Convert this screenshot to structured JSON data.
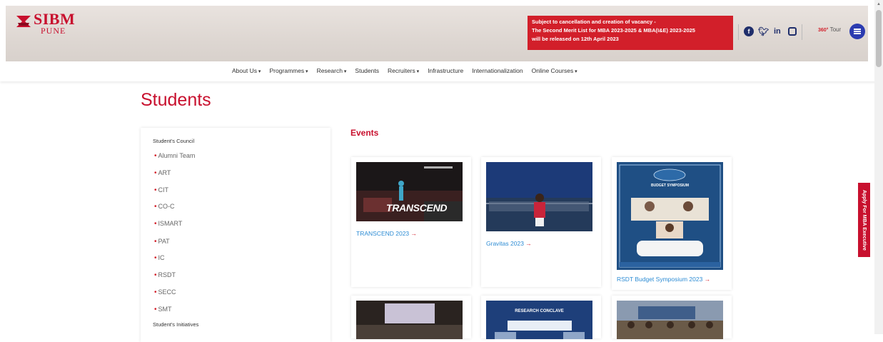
{
  "brand": {
    "name": "SIBM",
    "city": "PUNE",
    "accent": "#c8102e"
  },
  "notice": {
    "lines": [
      "Subject to cancellation and creation of vacancy -",
      "The Second Merit List for MBA 2023-2025 & MBA(I&E) 2023-2025",
      "will be released on 12th April 2023"
    ]
  },
  "social": {
    "icons": [
      "facebook-icon",
      "twitter-icon",
      "linkedin-icon",
      "instagram-icon"
    ],
    "tour_label": "Tour",
    "tour_prefix": "360°"
  },
  "nav": {
    "items": [
      {
        "label": "About Us",
        "dropdown": true
      },
      {
        "label": "Programmes",
        "dropdown": true
      },
      {
        "label": "Research",
        "dropdown": true
      },
      {
        "label": "Students",
        "dropdown": false
      },
      {
        "label": "Recruiters",
        "dropdown": true
      },
      {
        "label": "Infrastructure",
        "dropdown": false
      },
      {
        "label": "Internationalization",
        "dropdown": false
      },
      {
        "label": "Online Courses",
        "dropdown": true
      }
    ]
  },
  "page": {
    "title": "Students"
  },
  "sidebar": {
    "heading1": "Student's Council",
    "items": [
      "Alumni Team",
      "ART",
      "CIT",
      "CO-C",
      "ISMART",
      "PAT",
      "IC",
      "RSDT",
      "SECC",
      "SMT"
    ],
    "heading2": "Student's Initiatives"
  },
  "events": {
    "title": "Events",
    "cards": [
      {
        "caption": "TRANSCEND 2023",
        "img_text": "TRANSCEND"
      },
      {
        "caption": "Gravitas 2023",
        "img_text": ""
      },
      {
        "caption": "RSDT Budget Symposium 2023",
        "img_text": "BUDGET SYMPOSIUM"
      }
    ],
    "row2_img_text": [
      "",
      "RESEARCH CONCLAVE",
      ""
    ]
  },
  "apply_tab": {
    "label": "Apply For MBA Executive"
  }
}
